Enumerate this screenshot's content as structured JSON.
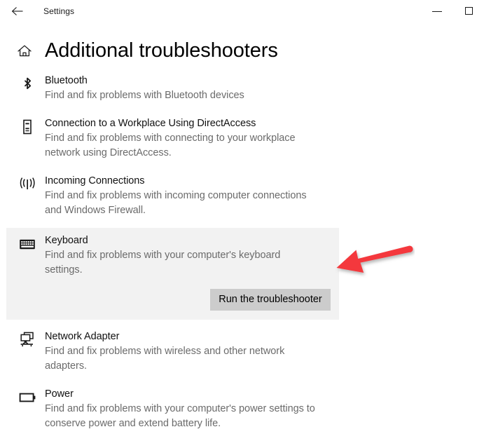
{
  "window": {
    "app_title": "Settings",
    "back_icon": "back-arrow-icon",
    "minimize_label": "Minimize",
    "maximize_label": "Maximize"
  },
  "header": {
    "home_icon": "home-icon",
    "title": "Additional troubleshooters"
  },
  "colors": {
    "selected_background": "#f2f2f2",
    "button_background": "#cccccc",
    "annotation_arrow": "#f4383c",
    "title_text": "#111111",
    "description_text": "#6b6b6b"
  },
  "troubleshooters": [
    {
      "icon": "bluetooth-icon",
      "title": "Bluetooth",
      "description": "Find and fix problems with Bluetooth devices",
      "selected": false
    },
    {
      "icon": "directaccess-device-icon",
      "title": "Connection to a Workplace Using DirectAccess",
      "description": "Find and fix problems with connecting to your workplace network using DirectAccess.",
      "selected": false
    },
    {
      "icon": "incoming-connections-icon",
      "title": "Incoming Connections",
      "description": "Find and fix problems with incoming computer connections and Windows Firewall.",
      "selected": false
    },
    {
      "icon": "keyboard-icon",
      "title": "Keyboard",
      "description": "Find and fix problems with your computer's keyboard settings.",
      "selected": true,
      "button_label": "Run the troubleshooter"
    },
    {
      "icon": "network-adapter-icon",
      "title": "Network Adapter",
      "description": "Find and fix problems with wireless and other network adapters.",
      "selected": false
    },
    {
      "icon": "power-battery-icon",
      "title": "Power",
      "description": "Find and fix problems with your computer's power settings to conserve power and extend battery life.",
      "selected": false
    }
  ],
  "annotation": {
    "arrow_name": "red-pointer-arrow",
    "points_at": "Run the troubleshooter"
  }
}
